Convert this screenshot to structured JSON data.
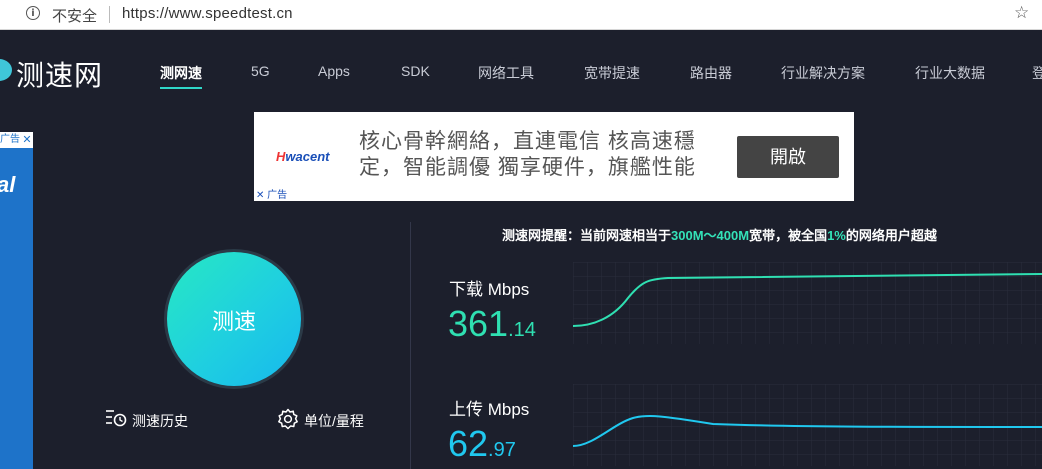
{
  "browser": {
    "security_label": "不安全",
    "url": "https://www.speedtest.cn",
    "info_icon": "info-icon",
    "star_icon": "bookmark-star-icon"
  },
  "site": {
    "logo_text": "测速网",
    "nav": [
      {
        "label": "测网速",
        "active": true
      },
      {
        "label": "5G"
      },
      {
        "label": "Apps"
      },
      {
        "label": "SDK"
      },
      {
        "label": "网络工具"
      },
      {
        "label": "宽带提速"
      },
      {
        "label": "路由器"
      },
      {
        "label": "行业解决方案"
      },
      {
        "label": "行业大数据"
      },
      {
        "label": "登"
      }
    ]
  },
  "side_ad": {
    "tag": "广告",
    "close": "✕",
    "text": "al"
  },
  "banner_ad": {
    "brand_prefix": "H",
    "brand_rest": "wacent",
    "text": "核心骨幹網絡，直連電信 核高速穩定，智能調優 獨享硬件，旗艦性能",
    "button": "開啟",
    "ad_tag": "✕ 广告"
  },
  "test": {
    "button": "测速",
    "history": "测速历史",
    "units": "单位/量程"
  },
  "notice": {
    "prefix": "测速网提醒：当前网速相当于",
    "range": "300M～400M",
    "middle": "宽带，被全国",
    "percent": "1%",
    "suffix": "的网络用户超越"
  },
  "download": {
    "label": "下载 Mbps",
    "int": "361",
    "frac": ".14"
  },
  "upload": {
    "label": "上传 Mbps",
    "int": "62",
    "frac": ".97"
  },
  "colors": {
    "background": "#1c1f2c",
    "accent_download": "#2fe0b2",
    "accent_upload": "#20c8ef"
  }
}
